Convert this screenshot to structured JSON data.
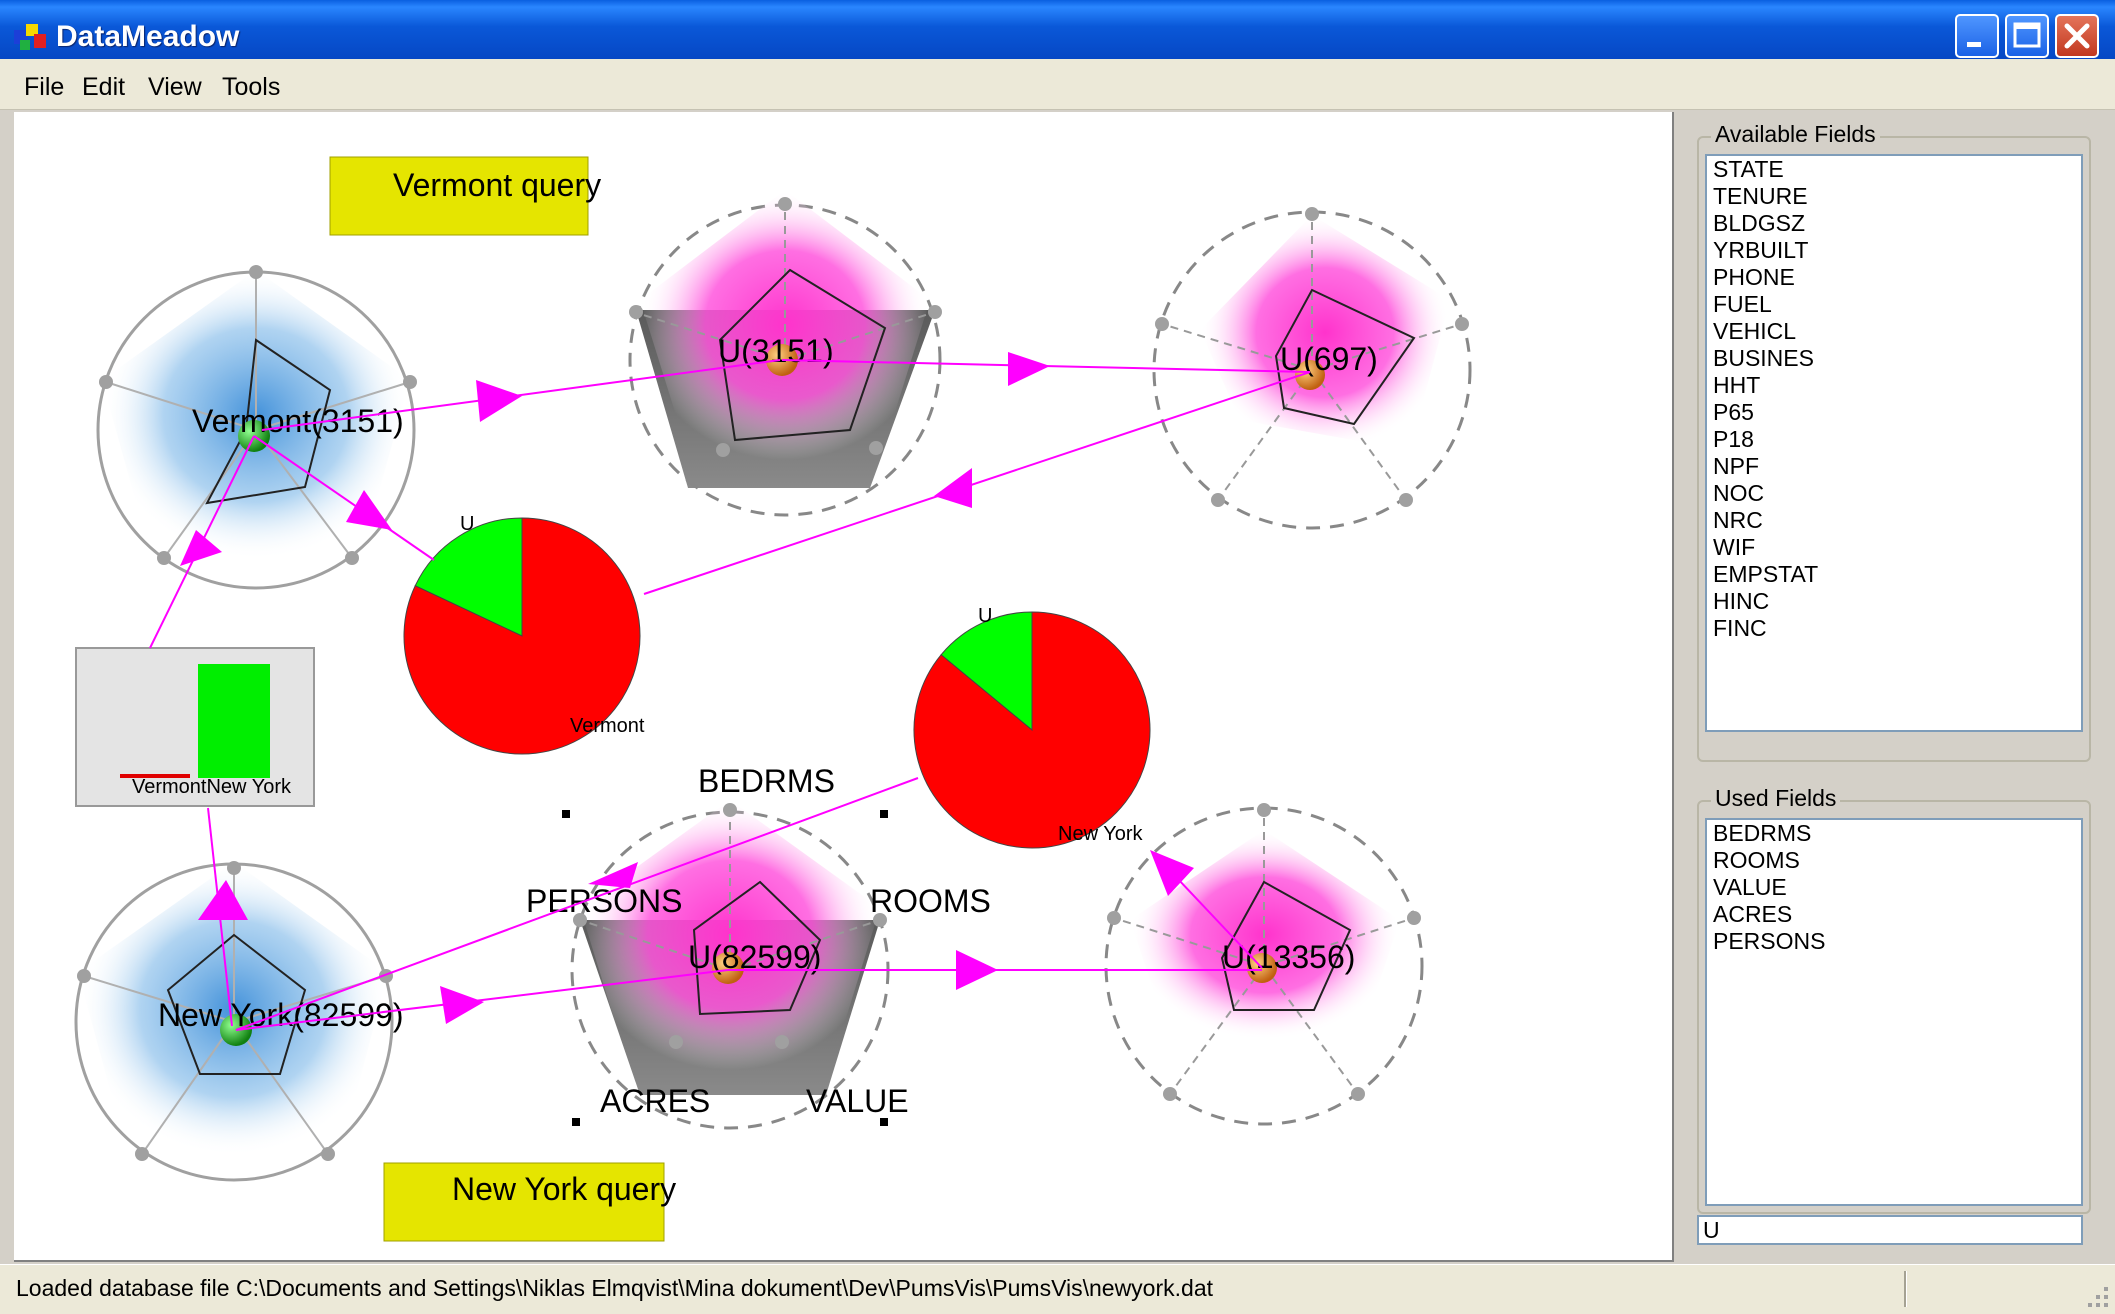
{
  "window": {
    "title": "DataMeadow"
  },
  "menu": [
    "File",
    "Edit",
    "View",
    "Tools"
  ],
  "canvas": {
    "labels": {
      "vermont_query": "Vermont query",
      "newyork_query": "New York query",
      "vermont_node": "Vermont(3151)",
      "newyork_node": "New York(82599)",
      "u3151": "U(3151)",
      "u697": "U(697)",
      "u82599": "U(82599)",
      "u13356": "U(13356)",
      "pie1_top": "U",
      "pie1_bottom": "Vermont",
      "pie2_top": "U",
      "pie2_bottom": "New York",
      "bar_labels": "VermontNew York",
      "axis_bedrms": "BEDRMS",
      "axis_rooms": "ROOMS",
      "axis_value": "VALUE",
      "axis_acres": "ACRES",
      "axis_persons": "PERSONS"
    },
    "pies": [
      {
        "name": "U vs Vermont",
        "slices": [
          {
            "label": "U",
            "fraction": 0.18,
            "color": "#00ff00"
          },
          {
            "label": "Vermont",
            "fraction": 0.82,
            "color": "#ff0000"
          }
        ]
      },
      {
        "name": "U vs New York",
        "slices": [
          {
            "label": "U",
            "fraction": 0.14,
            "color": "#00ff00"
          },
          {
            "label": "New York",
            "fraction": 0.86,
            "color": "#ff0000"
          }
        ]
      }
    ],
    "bars": [
      {
        "label": "Vermont",
        "fraction": 0.03,
        "color": "#e00000"
      },
      {
        "label": "New York",
        "fraction": 0.97,
        "color": "#00ee00"
      }
    ],
    "colors": {
      "link": "#ff00ff",
      "query_box": "#e5e500",
      "selection": "#ff00ff",
      "source_glow": "#3f8fcf"
    }
  },
  "available_fields": {
    "title": "Available Fields",
    "items": [
      "STATE",
      "TENURE",
      "BLDGSZ",
      "YRBUILT",
      "PHONE",
      "FUEL",
      "VEHICL",
      "BUSINES",
      "HHT",
      "P65",
      "P18",
      "NPF",
      "NOC",
      "NRC",
      "WIF",
      "EMPSTAT",
      "HINC",
      "FINC"
    ]
  },
  "used_fields": {
    "title": "Used Fields",
    "items": [
      "BEDRMS",
      "ROOMS",
      "VALUE",
      "ACRES",
      "PERSONS"
    ]
  },
  "filter": {
    "value": "U"
  },
  "status": {
    "text": "Loaded database file C:\\Documents and Settings\\Niklas Elmqvist\\Mina dokument\\Dev\\PumsVis\\PumsVis\\newyork.dat"
  }
}
